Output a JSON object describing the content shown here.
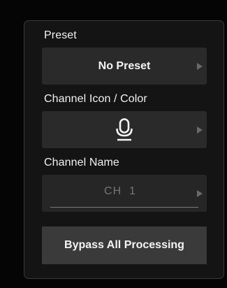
{
  "panel": {
    "preset": {
      "label": "Preset",
      "value": "No Preset",
      "arrow_icon": "triangle-right-icon"
    },
    "channel_icon": {
      "label": "Channel Icon / Color",
      "icon": "microphone-icon",
      "icon_color": "#f4f4f4",
      "arrow_icon": "triangle-right-icon"
    },
    "channel_name": {
      "label": "Channel Name",
      "placeholder": "CH  1",
      "arrow_icon": "triangle-right-icon"
    },
    "bypass_label": "Bypass All Processing"
  },
  "colors": {
    "background": "#050505",
    "panel": "#141414",
    "field": "#2a2a2a",
    "button": "#3a3a3a",
    "text": "#f4f4f4",
    "muted_text": "#8a8a8a"
  }
}
